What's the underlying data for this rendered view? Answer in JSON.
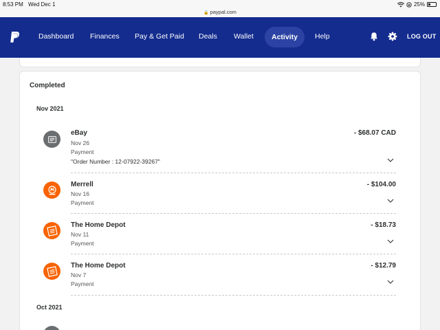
{
  "status_bar": {
    "time": "8:53 PM",
    "date": "Wed Dec 1",
    "url": "paypal.com",
    "battery": "25%"
  },
  "nav": {
    "items": [
      "Dashboard",
      "Finances",
      "Pay & Get Paid",
      "Deals",
      "Wallet",
      "Activity",
      "Help"
    ],
    "active": "Activity",
    "logout": "LOG OUT"
  },
  "activity": {
    "section_title": "Completed",
    "months": [
      "Nov 2021",
      "Oct 2021"
    ],
    "transactions": [
      {
        "merchant": "eBay",
        "date": "Nov 26",
        "type": "Payment",
        "note": "\"Order Number : 12-07922-39267\"",
        "amount": "- $68.07 CAD",
        "icon": "ebay-receipt-icon"
      },
      {
        "merchant": "Merrell",
        "date": "Nov 16",
        "type": "Payment",
        "amount": "- $104.00",
        "icon": "merrell-logo-icon"
      },
      {
        "merchant": "The Home Depot",
        "date": "Nov 11",
        "type": "Payment",
        "amount": "- $18.73",
        "icon": "home-depot-logo-icon"
      },
      {
        "merchant": "The Home Depot",
        "date": "Nov 7",
        "type": "Payment",
        "amount": "- $12.79",
        "icon": "home-depot-logo-icon"
      }
    ]
  },
  "colors": {
    "nav_bg": "#142c8e",
    "nav_active_bg": "#2c43a3",
    "merchant_orange": "#f96302",
    "ebay_icon_bg": "#6b6e70"
  }
}
